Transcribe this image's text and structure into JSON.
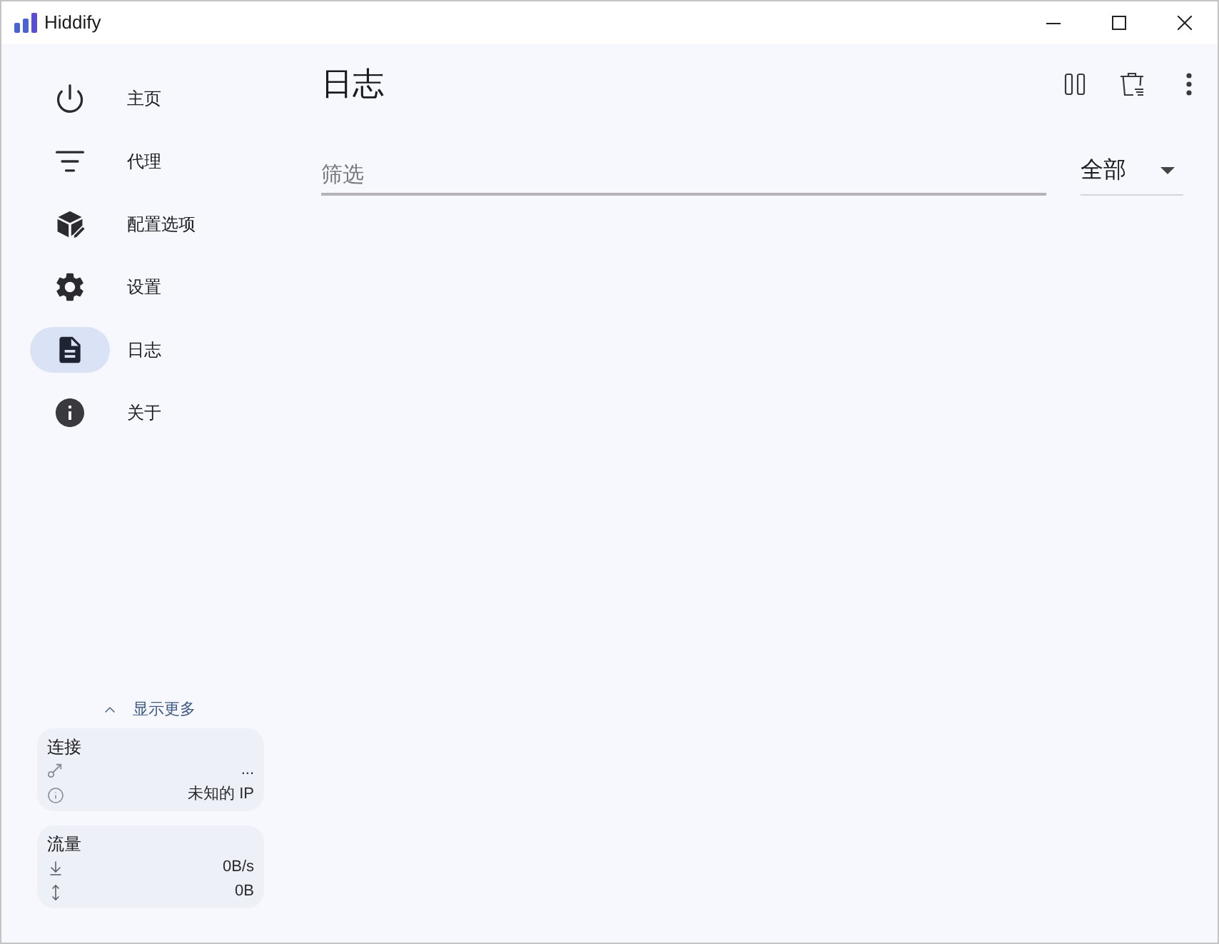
{
  "window": {
    "title": "Hiddify"
  },
  "sidebar": {
    "items": [
      {
        "label": "主页",
        "selected": false
      },
      {
        "label": "代理",
        "selected": false
      },
      {
        "label": "配置选项",
        "selected": false
      },
      {
        "label": "设置",
        "selected": false
      },
      {
        "label": "日志",
        "selected": true
      },
      {
        "label": "关于",
        "selected": false
      }
    ],
    "show_more": "显示更多",
    "cards": [
      {
        "title": "连接",
        "rows": [
          {
            "value": "..."
          },
          {
            "value": "未知的 IP"
          }
        ]
      },
      {
        "title": "流量",
        "rows": [
          {
            "value": "0B/s"
          },
          {
            "value": "0B"
          }
        ]
      }
    ]
  },
  "main": {
    "title": "日志",
    "filter": {
      "placeholder": "筛选"
    },
    "level_select": {
      "value": "全部"
    }
  }
}
